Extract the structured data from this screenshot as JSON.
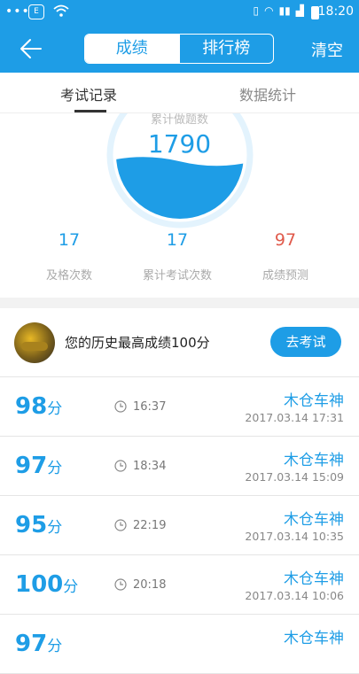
{
  "status_bar": {
    "time": "18:20",
    "sim_label": "E"
  },
  "app_bar": {
    "tabs": [
      {
        "label": "成绩"
      },
      {
        "label": "排行榜"
      }
    ],
    "clear_label": "清空"
  },
  "subtabs": [
    {
      "label": "考试记录"
    },
    {
      "label": "数据统计"
    }
  ],
  "summary": {
    "gauge_label": "累计做题数",
    "gauge_value": "1790",
    "gauge_fill_fraction": 0.45,
    "stats": [
      {
        "value": "17",
        "label": "及格次数",
        "color": "#1e9de6"
      },
      {
        "value": "17",
        "label": "累计考试次数",
        "color": "#1e9de6"
      },
      {
        "value": "97",
        "label": "成绩预测",
        "color": "#e05a4b"
      }
    ]
  },
  "best": {
    "text": "您的历史最高成绩100分",
    "button": "去考试"
  },
  "records": [
    {
      "score": "98",
      "unit": "分",
      "duration": "16:37",
      "user": "木仓车神",
      "date": "2017.03.14  17:31"
    },
    {
      "score": "97",
      "unit": "分",
      "duration": "18:34",
      "user": "木仓车神",
      "date": "2017.03.14  15:09"
    },
    {
      "score": "95",
      "unit": "分",
      "duration": "22:19",
      "user": "木仓车神",
      "date": "2017.03.14  10:35"
    },
    {
      "score": "100",
      "unit": "分",
      "duration": "20:18",
      "user": "木仓车神",
      "date": "2017.03.14  10:06"
    },
    {
      "score": "97",
      "unit": "分",
      "duration": "",
      "user": "木仓车神",
      "date": ""
    }
  ],
  "colors": {
    "primary": "#1e9de6",
    "prediction": "#e05a4b"
  }
}
